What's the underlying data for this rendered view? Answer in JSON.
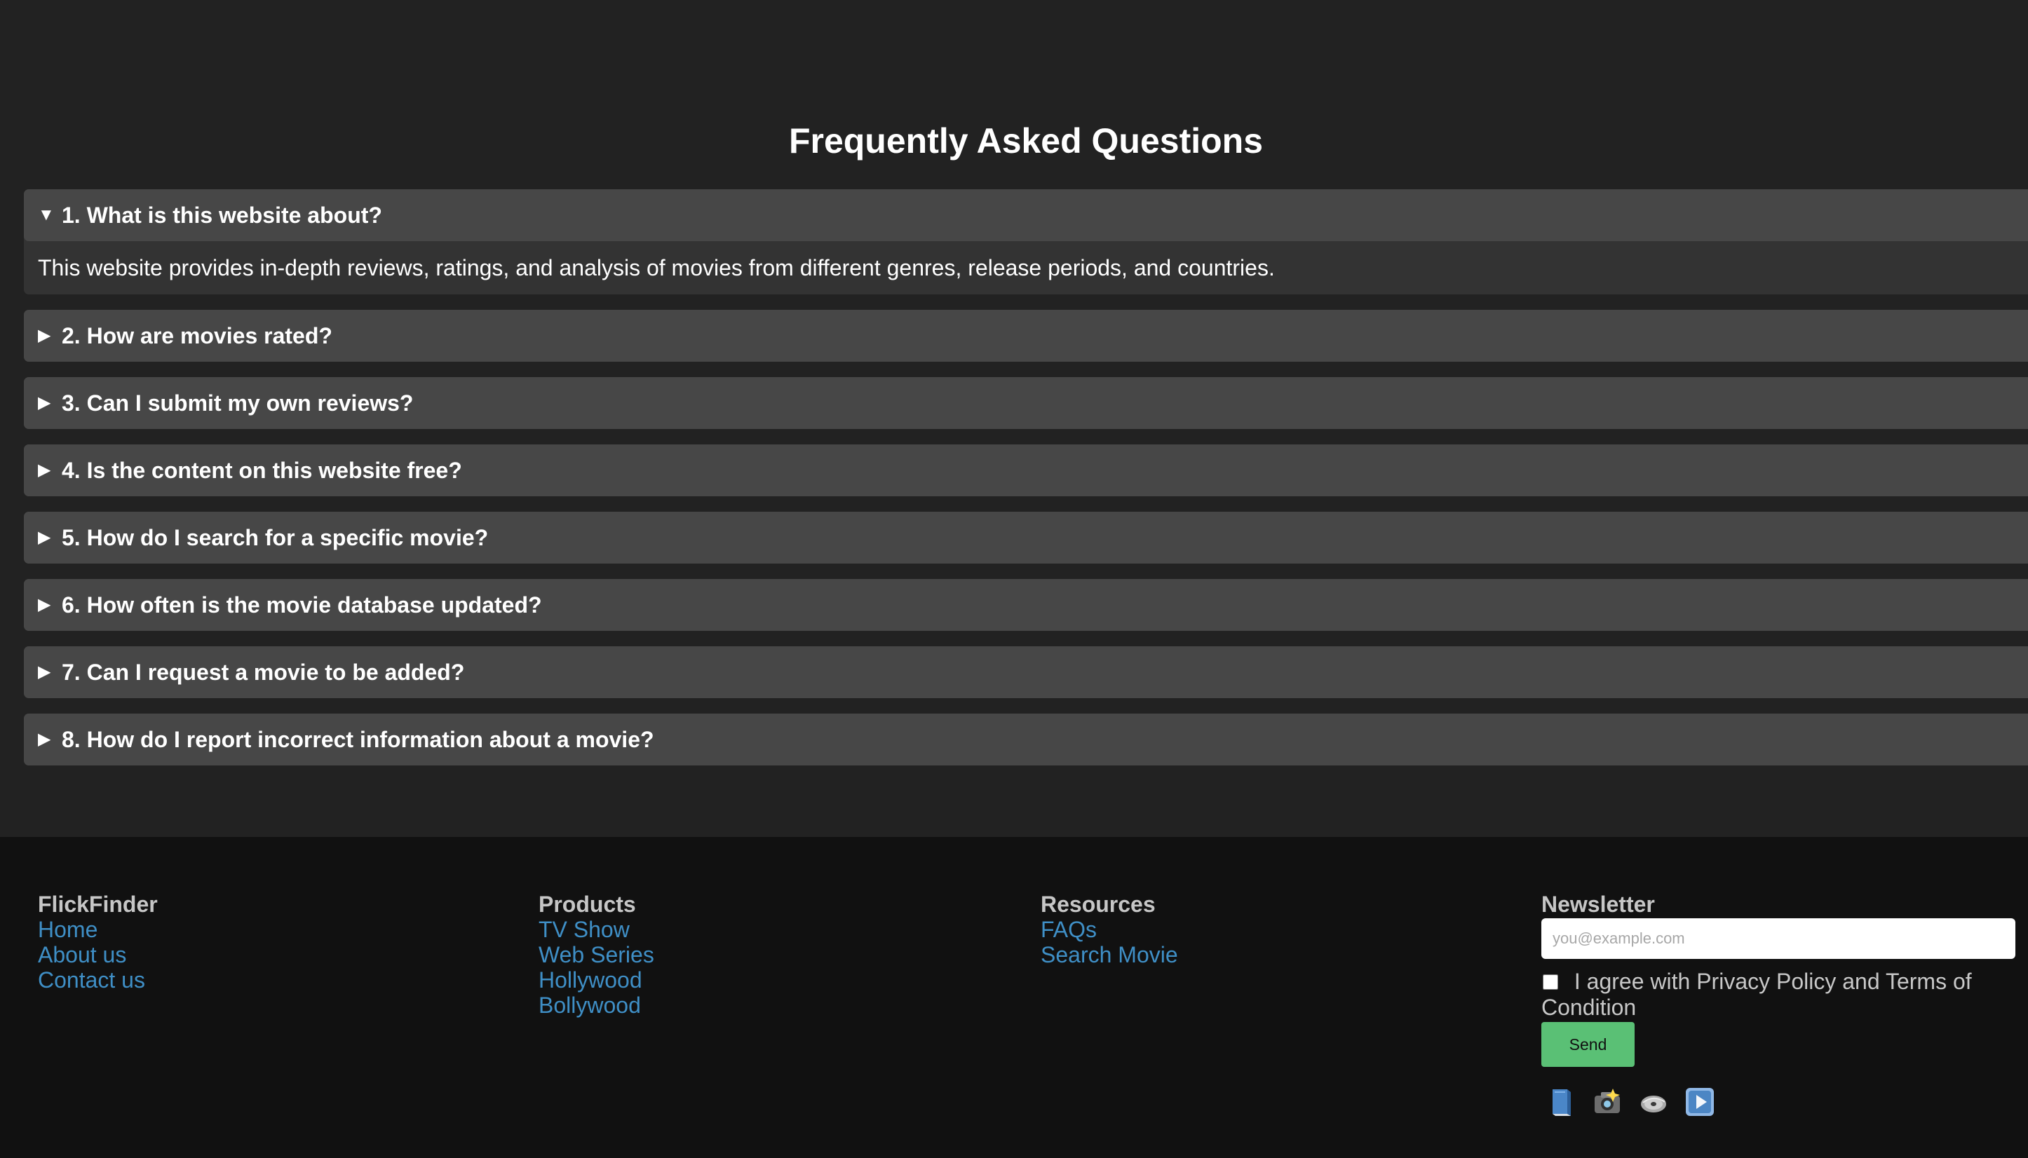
{
  "faq": {
    "title": "Frequently Asked Questions",
    "items": [
      {
        "number": "1.",
        "question": "1. What is this website about?",
        "answer": "This website provides in-depth reviews, ratings, and analysis of movies from different genres, release periods, and countries.",
        "arrow": "▼"
      },
      {
        "question": "2. How are movies rated?",
        "arrow": "▶"
      },
      {
        "question": "3. Can I submit my own reviews?",
        "arrow": "▶"
      },
      {
        "question": "4. Is the content on this website free?",
        "arrow": "▶"
      },
      {
        "question": "5. How do I search for a specific movie?",
        "arrow": "▶"
      },
      {
        "question": "6. How often is the movie database updated?",
        "arrow": "▶"
      },
      {
        "question": "7. Can I request a movie to be added?",
        "arrow": "▶"
      },
      {
        "question": "8. How do I report incorrect information about a movie?",
        "arrow": "▶"
      }
    ]
  },
  "footer": {
    "brand": {
      "heading": "FlickFinder",
      "links": [
        "Home",
        "About us",
        "Contact us"
      ]
    },
    "products": {
      "heading": "Products",
      "links": [
        "TV Show",
        "Web Series",
        "Hollywood",
        "Bollywood"
      ]
    },
    "resources": {
      "heading": "Resources",
      "links": [
        "FAQs",
        "Search Movie"
      ]
    },
    "newsletter": {
      "heading": "Newsletter",
      "placeholder": "you@example.com",
      "agree_text": "I agree with Privacy Policy and Terms of Condition",
      "send_label": "Send"
    },
    "social_icons": [
      "book-icon",
      "camera-icon",
      "disc-icon",
      "play-icon"
    ]
  },
  "colors": {
    "page_background": "#222222",
    "faq_question_background": "#474747",
    "faq_answer_background": "#333333",
    "footer_background": "#111111",
    "link": "#3f8fc6",
    "button": "#5ac075"
  }
}
